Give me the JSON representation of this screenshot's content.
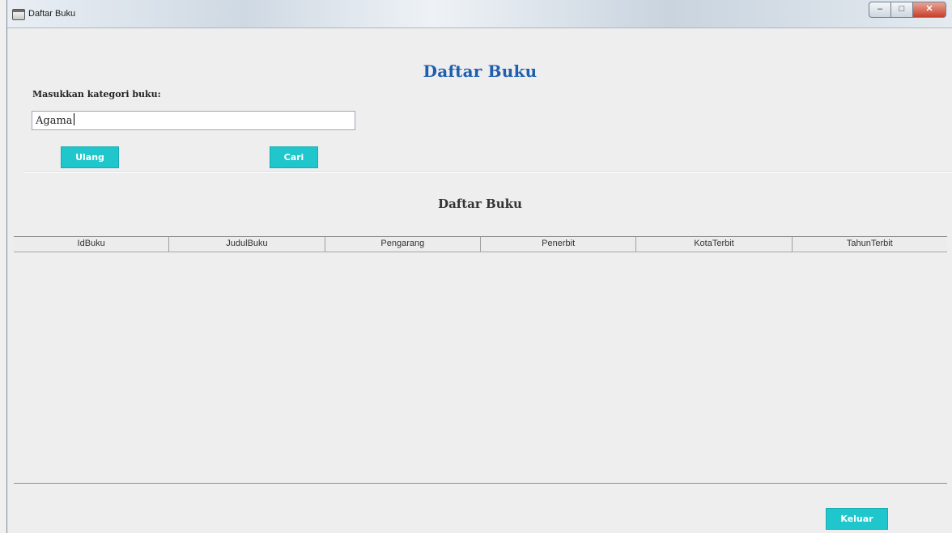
{
  "window": {
    "title": "Daftar Buku",
    "controls": [
      "–",
      "□",
      "✕"
    ]
  },
  "header": {
    "title": "Daftar Buku"
  },
  "form": {
    "label": "Masukkan kategori buku:",
    "input_value": "Agama",
    "reset_button": "Ulang",
    "search_button": "Cari"
  },
  "table": {
    "title": "Daftar Buku",
    "columns": [
      "IdBuku",
      "JudulBuku",
      "Pengarang",
      "Penerbit",
      "KotaTerbit",
      "TahunTerbit"
    ],
    "rows": []
  },
  "footer": {
    "exit_button": "Keluar"
  },
  "colors": {
    "accent": "#1fc6cc",
    "title": "#1f5fae"
  }
}
